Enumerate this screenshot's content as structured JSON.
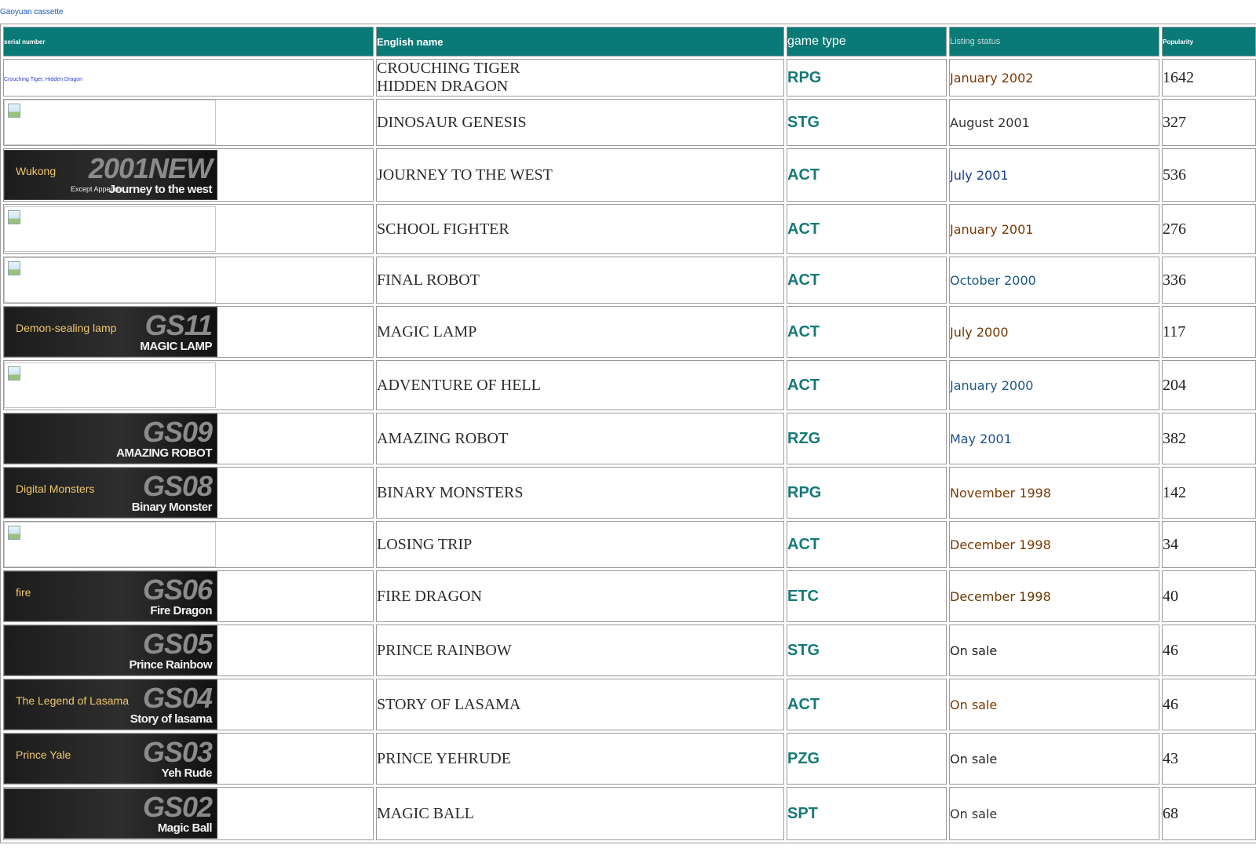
{
  "top_link": "Gaoyuan cassette",
  "headers": {
    "serial": "serial number",
    "name": "English name",
    "type": "game type",
    "status": "Listing status",
    "popularity": "Popularity"
  },
  "rows": [
    {
      "serial_text": "Crouching Tiger, Hidden Dragon",
      "banner": null,
      "name": "CROUCHING TIGER\nHIDDEN DRAGON",
      "type": "RPG",
      "status": "January 2002",
      "status_color": "#7a3a00",
      "popularity": "1642"
    },
    {
      "serial_text": "",
      "banner": null,
      "name": "DINOSAUR GENESIS",
      "type": "STG",
      "status": "August 2001",
      "status_color": "#333333",
      "popularity": "327"
    },
    {
      "serial_text": "",
      "banner": {
        "code": "2001NEW",
        "sub": "Journey to the west",
        "cn": "Wukong",
        "extra": "Except Appendix"
      },
      "name": "JOURNEY TO THE WEST",
      "type": "ACT",
      "status": "July 2001",
      "status_color": "#1a3f8f",
      "popularity": "536"
    },
    {
      "serial_text": "",
      "banner": null,
      "name": "SCHOOL FIGHTER",
      "type": "ACT",
      "status": "January 2001",
      "status_color": "#7a3a00",
      "popularity": "276"
    },
    {
      "serial_text": "",
      "banner": null,
      "name": "FINAL ROBOT",
      "type": "ACT",
      "status": "October 2000",
      "status_color": "#1a5a86",
      "popularity": "336"
    },
    {
      "serial_text": "",
      "banner": {
        "code": "GS11",
        "sub": "MAGIC LAMP",
        "cn": "Demon-sealing lamp",
        "extra": ""
      },
      "name": "MAGIC LAMP",
      "type": "ACT",
      "status": "July 2000",
      "status_color": "#6b3a00",
      "popularity": "117"
    },
    {
      "serial_text": "",
      "banner": null,
      "name": "ADVENTURE OF HELL",
      "type": "ACT",
      "status": "January 2000",
      "status_color": "#1a5a86",
      "popularity": "204"
    },
    {
      "serial_text": "",
      "banner": {
        "code": "GS09",
        "sub": "AMAZING ROBOT",
        "cn": "",
        "extra": ""
      },
      "name": "AMAZING ROBOT",
      "type": "RZG",
      "status": "May 2001",
      "status_color": "#1a4f8f",
      "popularity": "382"
    },
    {
      "serial_text": "",
      "banner": {
        "code": "GS08",
        "sub": "Binary Monster",
        "cn": "Digital Monsters",
        "extra": ""
      },
      "name": "BINARY MONSTERS",
      "type": "RPG",
      "status": "November 1998",
      "status_color": "#7a3a00",
      "popularity": "142"
    },
    {
      "serial_text": "",
      "banner": null,
      "name": "LOSING TRIP",
      "type": "ACT",
      "status": "December 1998",
      "status_color": "#7a3a00",
      "popularity": "34"
    },
    {
      "serial_text": "",
      "banner": {
        "code": "GS06",
        "sub": "Fire Dragon",
        "cn": "fire",
        "extra": ""
      },
      "name": "FIRE DRAGON",
      "type": "ETC",
      "status": "December 1998",
      "status_color": "#6b3a00",
      "popularity": "40"
    },
    {
      "serial_text": "",
      "banner": {
        "code": "GS05",
        "sub": "Prince Rainbow",
        "cn": "",
        "extra": ""
      },
      "name": "PRINCE RAINBOW",
      "type": "STG",
      "status": "On sale",
      "status_color": "#222222",
      "popularity": "46"
    },
    {
      "serial_text": "",
      "banner": {
        "code": "GS04",
        "sub": "Story of lasama",
        "cn": "The Legend of Lasama",
        "extra": ""
      },
      "name": "STORY OF LASAMA",
      "type": "ACT",
      "status": "On sale",
      "status_color": "#7a3a00",
      "popularity": "46"
    },
    {
      "serial_text": "",
      "banner": {
        "code": "GS03",
        "sub": "Yeh Rude",
        "cn": "Prince Yale",
        "extra": ""
      },
      "name": "PRINCE YEHRUDE",
      "type": "PZG",
      "status": "On sale",
      "status_color": "#222222",
      "popularity": "43"
    },
    {
      "serial_text": "",
      "banner": {
        "code": "GS02",
        "sub": "Magic Ball",
        "cn": "",
        "extra": ""
      },
      "name": "MAGIC BALL",
      "type": "SPT",
      "status": "On sale",
      "status_color": "#333333",
      "popularity": "68"
    }
  ]
}
